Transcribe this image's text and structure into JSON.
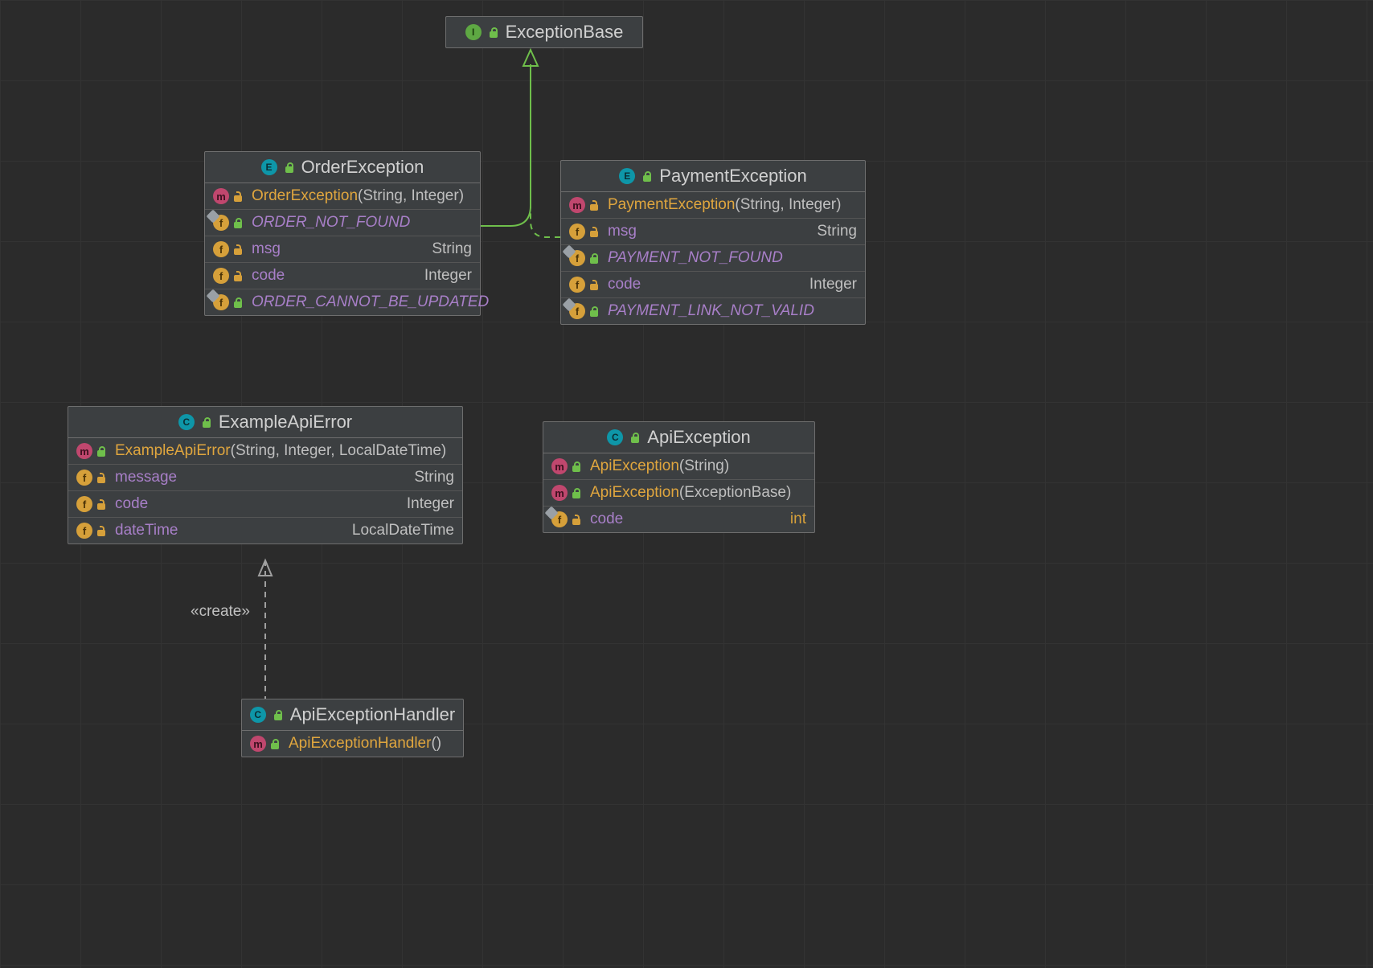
{
  "interface_box": {
    "title": "ExceptionBase"
  },
  "order_exception": {
    "title": "OrderException",
    "ctor_name": "OrderException",
    "ctor_p1": "String",
    "ctor_p2": "Integer",
    "const1": "ORDER_NOT_FOUND",
    "field_msg": "msg",
    "field_msg_type": "String",
    "field_code": "code",
    "field_code_type": "Integer",
    "const2": "ORDER_CANNOT_BE_UPDATED"
  },
  "payment_exception": {
    "title": "PaymentException",
    "ctor_name": "PaymentException",
    "ctor_p1": "String",
    "ctor_p2": "Integer",
    "field_msg": "msg",
    "field_msg_type": "String",
    "const1": "PAYMENT_NOT_FOUND",
    "field_code": "code",
    "field_code_type": "Integer",
    "const2": "PAYMENT_LINK_NOT_VALID"
  },
  "example_api_error": {
    "title": "ExampleApiError",
    "ctor_name": "ExampleApiError",
    "ctor_p1": "String",
    "ctor_p2": "Integer",
    "ctor_p3": "LocalDateTime",
    "f1": "message",
    "f1t": "String",
    "f2": "code",
    "f2t": "Integer",
    "f3": "dateTime",
    "f3t": "LocalDateTime"
  },
  "api_exception": {
    "title": "ApiException",
    "ctor1_name": "ApiException",
    "ctor1_p1": "String",
    "ctor2_name": "ApiException",
    "ctor2_p1": "ExceptionBase",
    "f1": "code",
    "f1t": "int"
  },
  "api_exception_handler": {
    "title": "ApiExceptionHandler",
    "ctor_name": "ApiExceptionHandler"
  },
  "create_label": "«create»"
}
